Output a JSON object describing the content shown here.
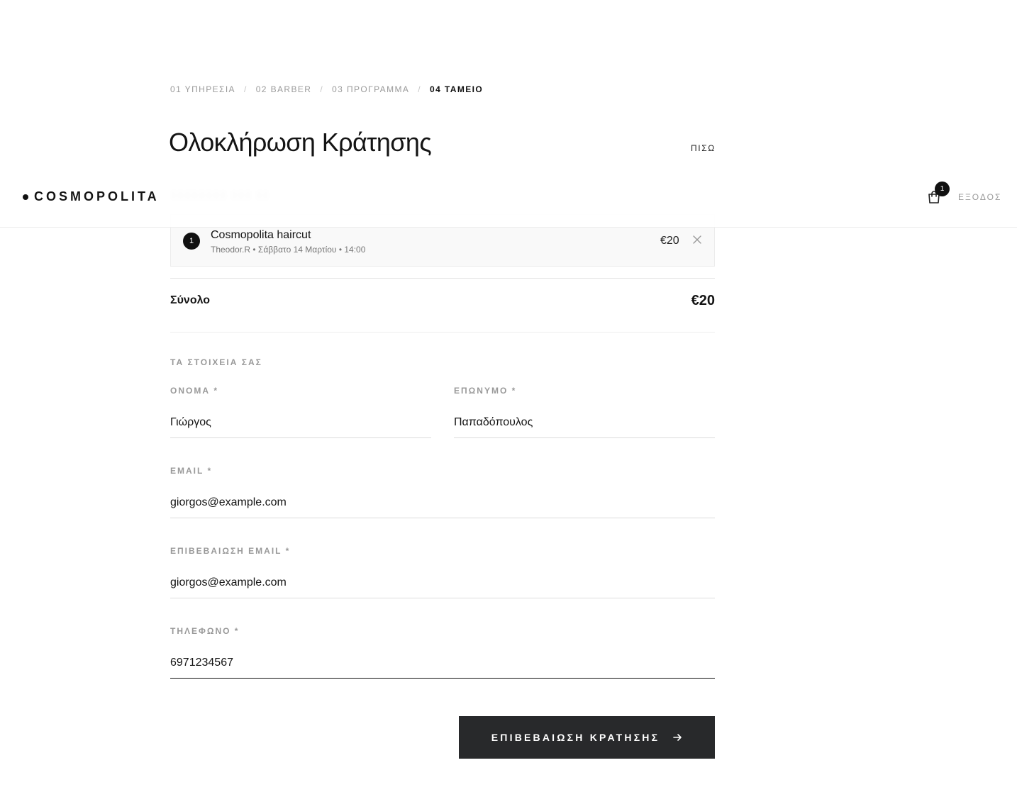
{
  "stepper": {
    "steps": [
      "01 ΥΠΗΡΕΣΙΑ",
      "02 BARBER",
      "03 ΠΡΟΓΡΑΜΜΑ",
      "04 ΤΑΜΕΙΟ"
    ],
    "separator": "/",
    "active_index": 3
  },
  "page_title": "Ολοκλήρωση Κράτησης",
  "back_label": "ΠΙΣΩ",
  "header": {
    "brand": "COSMOPOLITA",
    "cart_count": "1",
    "logout_label": "ΕΞΟΔΟΣ"
  },
  "cart": {
    "items": [
      {
        "index": "1",
        "name": "Cosmopolita haircut",
        "meta": "Theodor.R • Σάββατο 14 Μαρτίου • 14:00",
        "price": "€20"
      }
    ],
    "total_label": "Σύνολο",
    "total_value": "€20"
  },
  "form": {
    "section_title": "ΤΑ ΣΤΟΙΧΕΙΑ ΣΑΣ",
    "first_name": {
      "label": "ΟΝΟΜΑ *",
      "value": "Γιώργος"
    },
    "last_name": {
      "label": "ΕΠΩΝΥΜΟ *",
      "value": "Παπαδόπουλος"
    },
    "email": {
      "label": "EMAIL *",
      "value": "giorgos@example.com"
    },
    "email_confirm": {
      "label": "ΕΠΙΒΕΒΑΙΩΣΗ EMAIL *",
      "value": "giorgos@example.com"
    },
    "phone": {
      "label": "ΤΗΛΕΦΩΝΟ *",
      "value": "6971234567"
    }
  },
  "submit_label": "ΕΠΙΒΕΒΑΙΩΣΗ ΚΡΑΤΗΣΗΣ",
  "colors": {
    "primary_button": "#28292b",
    "text": "#141414",
    "muted": "#999999"
  }
}
